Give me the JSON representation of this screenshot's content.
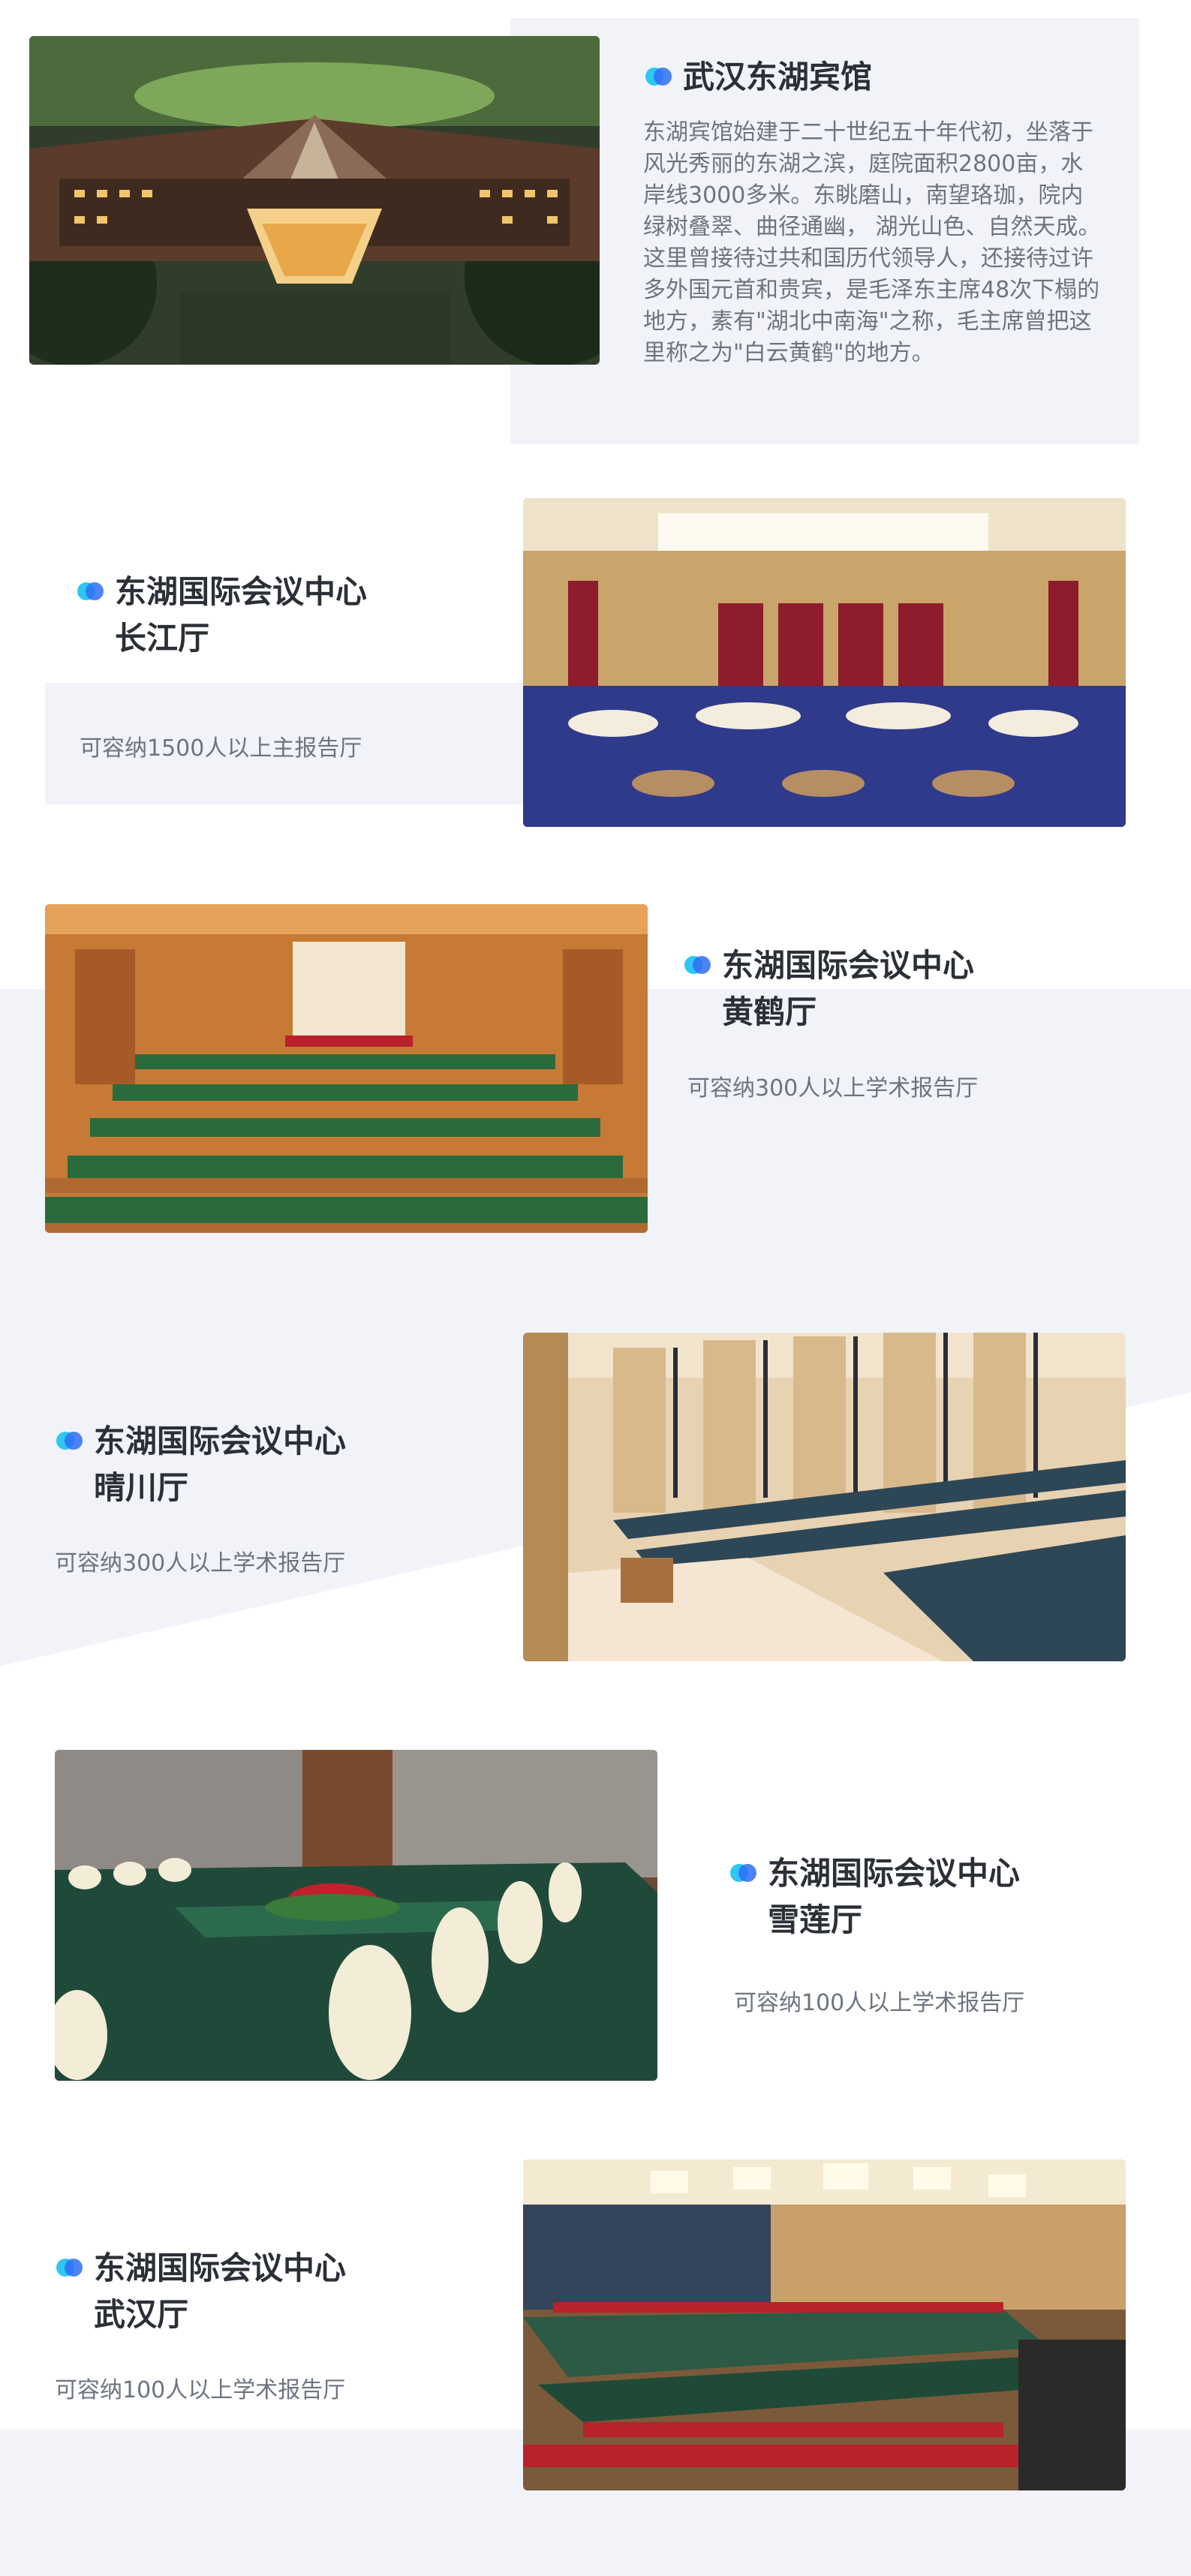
{
  "hotel": {
    "title": "武汉东湖宾馆",
    "description": "东湖宾馆始建于二十世纪五十年代初，坐落于风光秀丽的东湖之滨，庭院面积2800亩，水岸线3000多米。东眺磨山，南望珞珈，院内绿树叠翠、曲径通幽， 湖光山色、自然天成。这里曾接待过共和国历代领导人，还接待过许多外国元首和贵宾，是毛泽东主席48次下榻的地方，素有\"湖北中南海\"之称，毛主席曾把这里称之为\"白云黄鹤\"的地方。"
  },
  "halls": [
    {
      "title_line1": "东湖国际会议中心",
      "title_line2": "长江厅",
      "capacity": "可容纳1500人以上主报告厅"
    },
    {
      "title_line1": "东湖国际会议中心",
      "title_line2": "黄鹤厅",
      "capacity": "可容纳300人以上学术报告厅"
    },
    {
      "title_line1": "东湖国际会议中心",
      "title_line2": "晴川厅",
      "capacity": "可容纳300人以上学术报告厅"
    },
    {
      "title_line1": "东湖国际会议中心",
      "title_line2": "雪莲厅",
      "capacity": "可容纳100人以上学术报告厅"
    },
    {
      "title_line1": "东湖国际会议中心",
      "title_line2": "武汉厅",
      "capacity": "可容纳100人以上学术报告厅"
    }
  ],
  "colors": {
    "section_bg": "#f1f3f8",
    "dot_light": "#2ec7f3",
    "dot_dark": "#2f6df5",
    "title": "#2b2f36",
    "body_text": "#6d7480"
  }
}
